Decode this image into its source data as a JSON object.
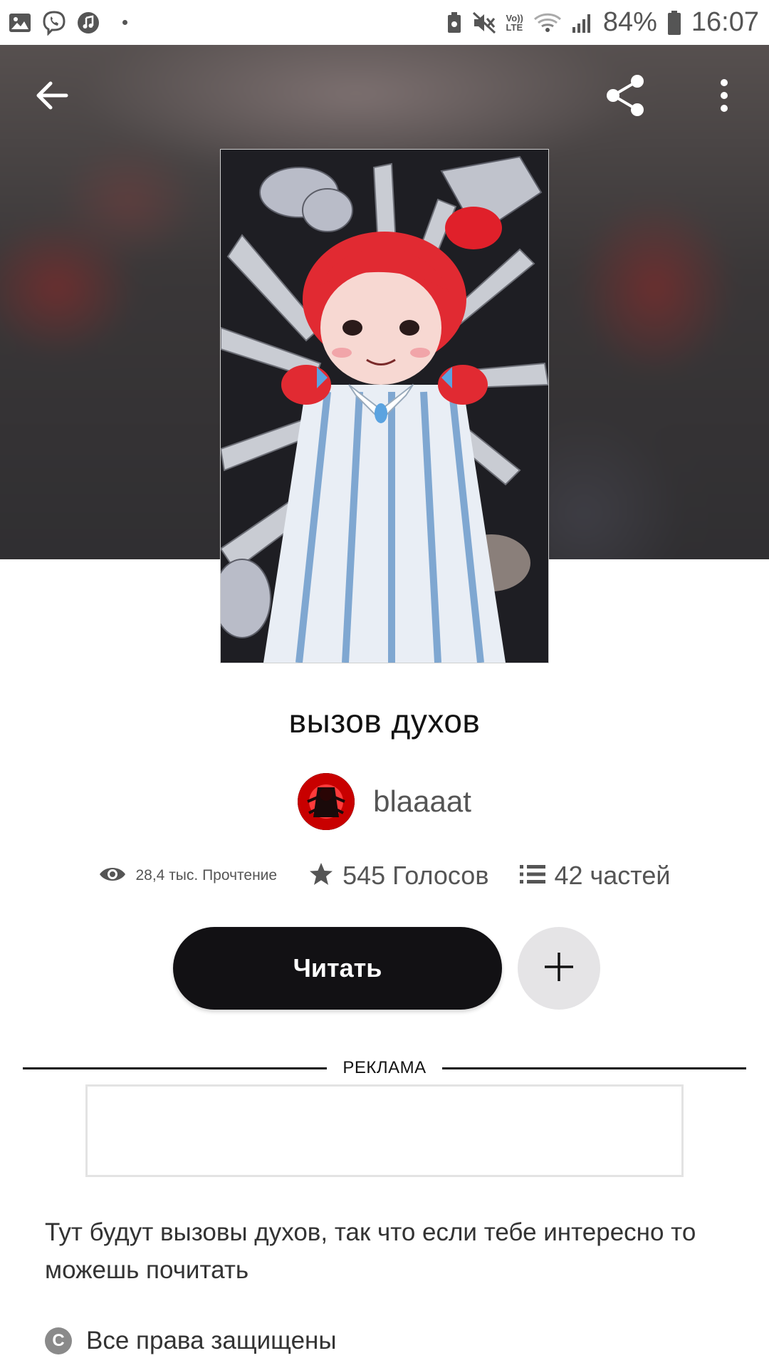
{
  "status_bar": {
    "battery_percent": "84%",
    "time": "16:07",
    "network_label_top": "Vo))",
    "network_label_bottom": "LTE",
    "icons": [
      "gallery-icon",
      "viber-icon",
      "music-icon",
      "dot-icon",
      "nfc-icon",
      "mute-icon",
      "volte-icon",
      "wifi-icon",
      "signal-icon",
      "battery-icon"
    ]
  },
  "header": {
    "icons": [
      "back-arrow-icon",
      "share-icon",
      "more-vert-icon"
    ]
  },
  "story": {
    "title": "вызов духов",
    "author": "blaaaat",
    "stats": {
      "reads": "28,4 тыс. Прочтение",
      "votes": "545 Голосов",
      "parts": "42 частей"
    },
    "read_label": "Читать",
    "add_label": "+"
  },
  "ad": {
    "label": "РЕКЛАМА"
  },
  "description": "Тут будут вызовы духов, так что если тебе интересно то можешь почитать",
  "rights": {
    "icon_glyph": "C",
    "text": "Все права защищены"
  },
  "colors": {
    "read_button_bg": "#121114",
    "add_button_bg": "#e5e4e6",
    "text_primary": "#121212",
    "text_secondary": "#555555"
  }
}
